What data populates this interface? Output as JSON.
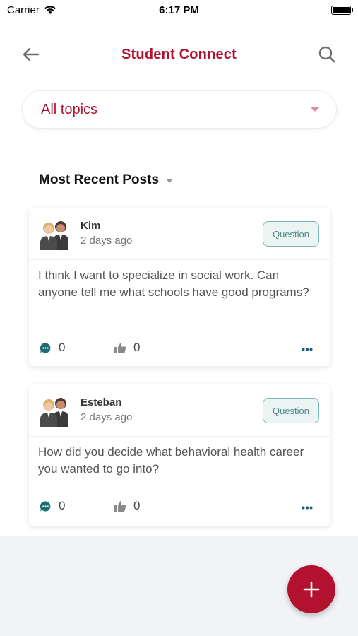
{
  "status_bar": {
    "carrier": "Carrier",
    "time": "6:17 PM"
  },
  "header": {
    "title": "Student Connect",
    "back_icon": "arrow-left-icon",
    "search_icon": "search-icon"
  },
  "filter": {
    "selected": "All topics"
  },
  "section": {
    "title": "Most Recent Posts"
  },
  "posts": [
    {
      "author": "Kim",
      "time_ago": "2 days ago",
      "tag": "Question",
      "body": "I think I want to specialize in social work. Can anyone tell me what schools have good programs?",
      "comments": "0",
      "likes": "0"
    },
    {
      "author": "Esteban",
      "time_ago": "2 days ago",
      "tag": "Question",
      "body": "How did you decide what behavioral health career you wanted to go into?",
      "comments": "0",
      "likes": "0"
    }
  ],
  "colors": {
    "brand": "#b3122e",
    "teal": "#1c6e72",
    "badge_border": "#7fb7b5",
    "bottom_bg": "#f2f3f6"
  }
}
